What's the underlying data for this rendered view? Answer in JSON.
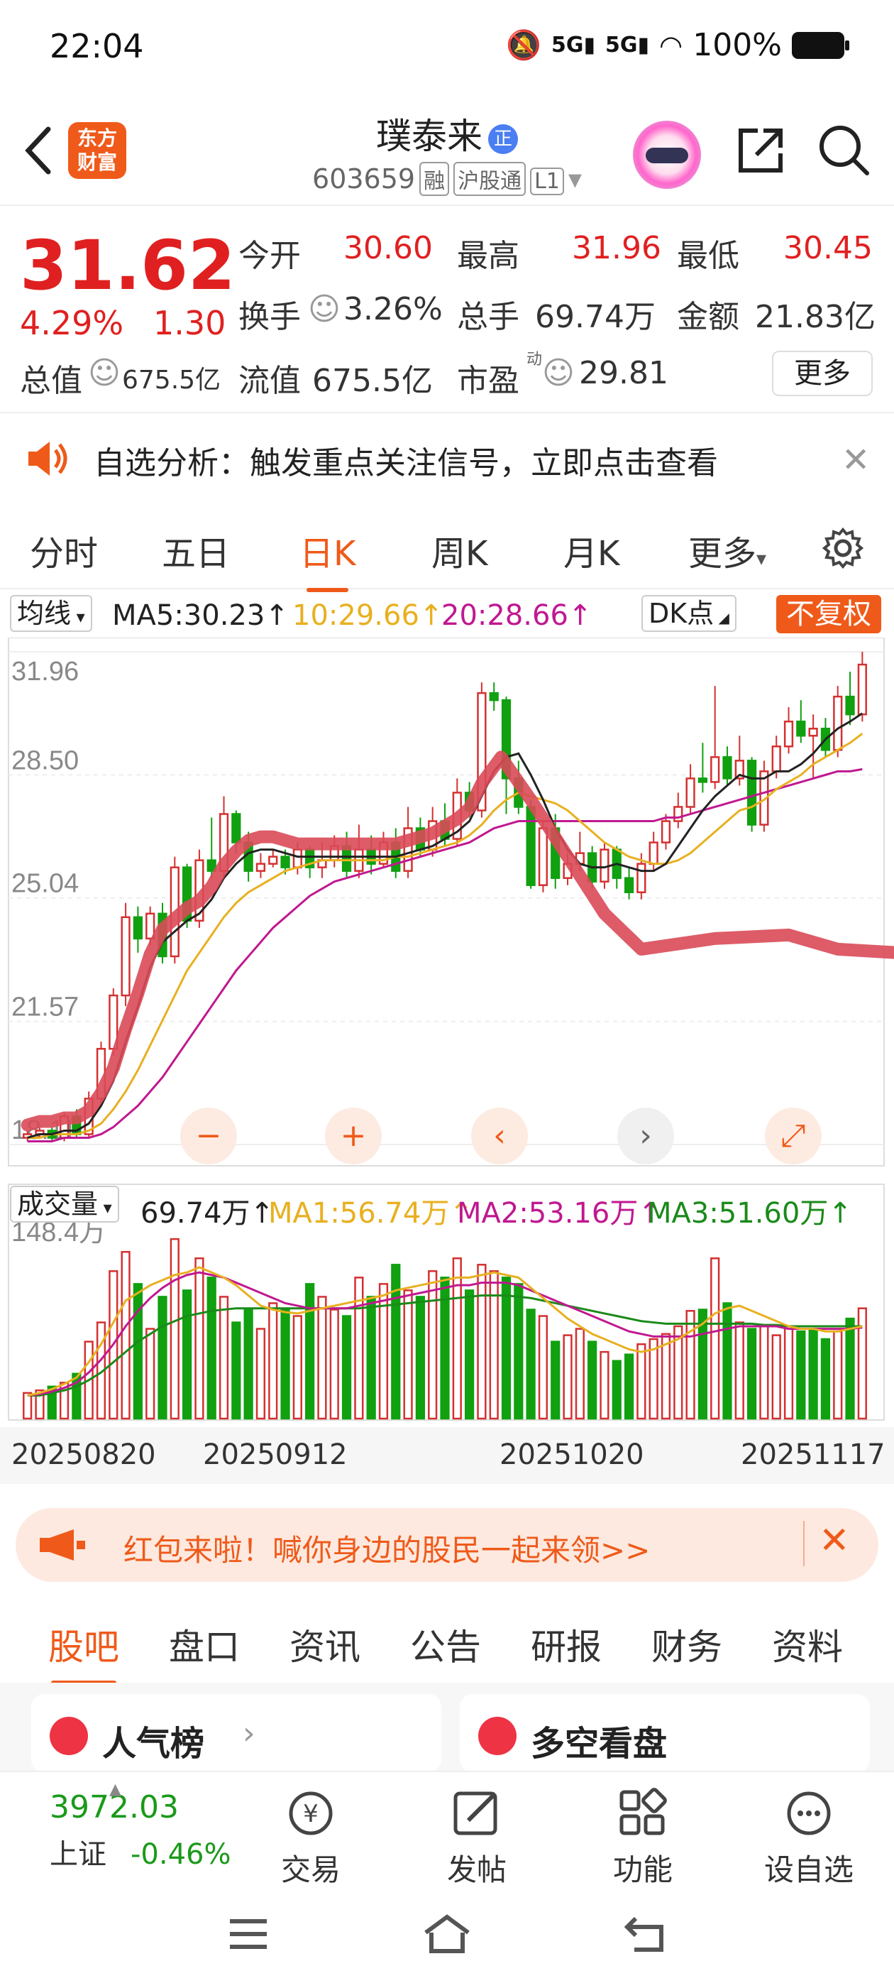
{
  "status": {
    "time": "22:04",
    "network": "5G",
    "battery": "100%"
  },
  "header": {
    "logo_line1": "东方",
    "logo_line2": "财富",
    "name": "璞泰来",
    "badge": "正",
    "code": "603659",
    "tags": [
      "融",
      "沪股通",
      "L1"
    ]
  },
  "quote": {
    "price": "31.62",
    "pct": "4.29%",
    "change": "1.30",
    "open_label": "今开",
    "open": "30.60",
    "high_label": "最高",
    "high": "31.96",
    "low_label": "最低",
    "low": "30.45",
    "turnover_label": "换手",
    "turnover": "3.26%",
    "volume_label": "总手",
    "volume": "69.74万",
    "amount_label": "金额",
    "amount": "21.83亿",
    "mcap_label": "总值",
    "mcap": "675.5亿",
    "float_label": "流值",
    "float": "675.5亿",
    "pe_label": "市盈",
    "pe_sup": "动",
    "pe": "29.81",
    "more": "更多"
  },
  "notice": {
    "text": "自选分析：触发重点关注信号，立即点击查看"
  },
  "tabs": [
    "分时",
    "五日",
    "日K",
    "周K",
    "月K",
    "更多"
  ],
  "ma": {
    "selector": "均线",
    "ma5": "MA5:30.23",
    "ma10": "10:29.66",
    "ma20": "20:28.66",
    "dk": "DK点",
    "restore": "不复权"
  },
  "vol": {
    "selector": "成交量",
    "value": "69.74万",
    "ma1": "MA1:56.74万",
    "ma2": "MA2:53.16万",
    "ma3": "MA3:51.60万",
    "max": "148.4万"
  },
  "chart_data": {
    "type": "candlestick",
    "y_ticks": [
      "31.96",
      "28.50",
      "25.04",
      "21.57",
      "18.11"
    ],
    "dates": [
      "20250820",
      "20250912",
      "20251020",
      "20251117"
    ],
    "colors": {
      "up": "#d43030",
      "down": "#10a010",
      "ma5": "#222222",
      "ma10": "#e8b020",
      "ma20": "#c01890",
      "ma3": "#1a8a1a"
    },
    "ylim": [
      18.11,
      31.96
    ],
    "candles": [
      [
        18.3,
        18.4,
        18.2,
        18.5
      ],
      [
        18.4,
        18.5,
        18.3,
        18.6
      ],
      [
        18.5,
        18.3,
        18.2,
        18.6
      ],
      [
        18.3,
        18.9,
        18.2,
        19.0
      ],
      [
        18.9,
        18.4,
        18.3,
        19.1
      ],
      [
        18.4,
        19.4,
        18.3,
        19.6
      ],
      [
        19.4,
        20.8,
        19.2,
        21.0
      ],
      [
        20.8,
        22.3,
        20.6,
        22.5
      ],
      [
        22.3,
        24.5,
        22.0,
        24.9
      ],
      [
        24.5,
        23.9,
        23.5,
        24.8
      ],
      [
        23.9,
        24.6,
        23.7,
        24.8
      ],
      [
        24.6,
        23.4,
        23.2,
        24.9
      ],
      [
        23.4,
        25.9,
        23.2,
        26.2
      ],
      [
        25.9,
        24.4,
        24.2,
        26.0
      ],
      [
        24.4,
        26.1,
        24.2,
        26.4
      ],
      [
        26.1,
        25.8,
        25.6,
        27.3
      ],
      [
        25.8,
        27.4,
        25.6,
        27.9
      ],
      [
        27.4,
        26.6,
        26.3,
        27.5
      ],
      [
        26.6,
        25.8,
        25.5,
        26.9
      ],
      [
        25.8,
        26.0,
        25.6,
        26.3
      ],
      [
        26.0,
        26.2,
        25.9,
        26.4
      ],
      [
        26.2,
        25.9,
        25.7,
        26.4
      ],
      [
        25.9,
        26.4,
        25.7,
        26.6
      ],
      [
        26.4,
        25.9,
        25.6,
        26.5
      ],
      [
        25.9,
        26.1,
        25.6,
        26.6
      ],
      [
        26.1,
        26.5,
        25.9,
        26.8
      ],
      [
        26.5,
        25.8,
        25.6,
        26.9
      ],
      [
        25.8,
        26.4,
        25.6,
        27.1
      ],
      [
        26.4,
        26.0,
        25.7,
        26.8
      ],
      [
        26.0,
        26.6,
        25.9,
        26.9
      ],
      [
        26.6,
        25.8,
        25.6,
        27.0
      ],
      [
        25.8,
        27.0,
        25.6,
        27.6
      ],
      [
        27.0,
        26.4,
        26.2,
        27.3
      ],
      [
        26.4,
        27.2,
        26.2,
        27.6
      ],
      [
        27.2,
        26.7,
        26.5,
        27.7
      ],
      [
        26.7,
        28.0,
        26.5,
        28.4
      ],
      [
        28.0,
        27.5,
        27.3,
        28.3
      ],
      [
        27.5,
        30.8,
        27.3,
        31.1
      ],
      [
        30.8,
        30.6,
        30.3,
        31.1
      ],
      [
        30.6,
        28.4,
        27.4,
        30.7
      ],
      [
        28.4,
        27.6,
        27.4,
        28.9
      ],
      [
        27.6,
        25.4,
        25.3,
        27.8
      ],
      [
        25.4,
        27.0,
        25.2,
        27.2
      ],
      [
        27.0,
        25.6,
        25.3,
        27.4
      ],
      [
        25.6,
        26.0,
        25.4,
        26.3
      ],
      [
        26.0,
        26.3,
        25.8,
        26.9
      ],
      [
        26.3,
        25.5,
        25.3,
        26.5
      ],
      [
        25.5,
        26.4,
        25.3,
        26.6
      ],
      [
        26.4,
        25.6,
        25.3,
        26.5
      ],
      [
        25.6,
        25.2,
        25.0,
        25.9
      ],
      [
        25.2,
        26.0,
        25.0,
        26.3
      ],
      [
        26.0,
        26.6,
        25.8,
        26.9
      ],
      [
        26.6,
        27.2,
        26.4,
        27.4
      ],
      [
        27.2,
        27.6,
        27.0,
        28.0
      ],
      [
        27.6,
        28.4,
        27.4,
        28.8
      ],
      [
        28.4,
        28.3,
        28.0,
        29.4
      ],
      [
        28.3,
        29.0,
        28.1,
        31.0
      ],
      [
        29.0,
        28.4,
        28.2,
        29.3
      ],
      [
        28.4,
        28.9,
        28.2,
        29.6
      ],
      [
        28.9,
        27.1,
        26.9,
        29.0
      ],
      [
        27.1,
        28.6,
        26.9,
        28.9
      ],
      [
        28.6,
        29.3,
        28.4,
        29.6
      ],
      [
        29.3,
        30.0,
        29.1,
        30.4
      ],
      [
        30.0,
        29.6,
        29.4,
        30.6
      ],
      [
        29.6,
        29.8,
        28.4,
        30.2
      ],
      [
        29.8,
        29.2,
        29.0,
        30.1
      ],
      [
        29.2,
        30.7,
        29.0,
        31.0
      ],
      [
        30.7,
        30.2,
        29.9,
        31.4
      ],
      [
        30.2,
        31.6,
        30.0,
        31.96
      ]
    ],
    "ma5": [
      18.3,
      18.4,
      18.4,
      18.5,
      18.5,
      18.7,
      19.2,
      19.9,
      21.0,
      22.0,
      23.1,
      23.8,
      24.1,
      24.4,
      24.6,
      25.0,
      25.6,
      26.0,
      26.3,
      26.4,
      26.4,
      26.3,
      26.2,
      26.2,
      26.2,
      26.2,
      26.2,
      26.2,
      26.2,
      26.2,
      26.2,
      26.3,
      26.4,
      26.5,
      26.7,
      26.9,
      27.2,
      27.9,
      28.6,
      29.0,
      29.1,
      28.5,
      27.8,
      27.0,
      26.4,
      26.0,
      25.9,
      25.9,
      26.0,
      25.9,
      25.8,
      25.8,
      26.0,
      26.5,
      27.0,
      27.5,
      27.9,
      28.2,
      28.5,
      28.4,
      28.4,
      28.6,
      28.6,
      28.8,
      29.1,
      29.5,
      29.8,
      30.0,
      30.23
    ],
    "ma10": [
      18.3,
      18.3,
      18.4,
      18.4,
      18.4,
      18.5,
      18.7,
      19.1,
      19.6,
      20.2,
      20.9,
      21.6,
      22.3,
      23.0,
      23.5,
      24.0,
      24.5,
      24.9,
      25.2,
      25.4,
      25.6,
      25.8,
      25.9,
      26.0,
      26.1,
      26.1,
      26.1,
      26.1,
      26.1,
      26.1,
      26.2,
      26.2,
      26.3,
      26.4,
      26.5,
      26.6,
      26.8,
      27.1,
      27.5,
      27.8,
      28.0,
      27.9,
      27.8,
      27.7,
      27.5,
      27.2,
      26.9,
      26.6,
      26.4,
      26.2,
      26.1,
      26.0,
      26.0,
      26.1,
      26.3,
      26.6,
      26.9,
      27.2,
      27.5,
      27.6,
      27.8,
      28.1,
      28.3,
      28.5,
      28.8,
      29.0,
      29.2,
      29.4,
      29.66
    ],
    "ma20": [
      18.2,
      18.2,
      18.2,
      18.3,
      18.3,
      18.3,
      18.4,
      18.6,
      18.9,
      19.2,
      19.6,
      20.0,
      20.5,
      21.0,
      21.5,
      22.0,
      22.5,
      23.0,
      23.4,
      23.8,
      24.2,
      24.5,
      24.8,
      25.1,
      25.3,
      25.5,
      25.6,
      25.7,
      25.8,
      25.9,
      26.0,
      26.1,
      26.2,
      26.3,
      26.4,
      26.5,
      26.6,
      26.8,
      27.0,
      27.1,
      27.2,
      27.2,
      27.2,
      27.2,
      27.2,
      27.2,
      27.2,
      27.2,
      27.2,
      27.2,
      27.2,
      27.2,
      27.3,
      27.3,
      27.4,
      27.5,
      27.6,
      27.7,
      27.8,
      27.9,
      28.0,
      28.1,
      28.2,
      28.3,
      28.4,
      28.5,
      28.6,
      28.6,
      28.66
    ],
    "volumes": [
      20,
      22,
      25,
      28,
      35,
      60,
      75,
      115,
      130,
      105,
      70,
      95,
      140,
      100,
      125,
      110,
      95,
      75,
      85,
      70,
      90,
      85,
      80,
      105,
      95,
      85,
      80,
      110,
      95,
      105,
      120,
      100,
      95,
      115,
      110,
      125,
      100,
      120,
      115,
      110,
      105,
      85,
      80,
      60,
      65,
      70,
      60,
      52,
      45,
      50,
      58,
      62,
      66,
      72,
      84,
      85,
      125,
      90,
      75,
      70,
      72,
      65,
      72,
      68,
      70,
      62,
      68,
      78,
      86
    ],
    "vol_up": [
      true,
      true,
      false,
      true,
      false,
      true,
      true,
      true,
      true,
      false,
      true,
      false,
      true,
      false,
      true,
      false,
      true,
      false,
      false,
      true,
      true,
      false,
      true,
      false,
      true,
      true,
      false,
      true,
      false,
      true,
      false,
      true,
      false,
      true,
      false,
      true,
      false,
      true,
      true,
      false,
      false,
      false,
      true,
      false,
      true,
      true,
      false,
      true,
      false,
      false,
      true,
      true,
      true,
      true,
      true,
      false,
      true,
      false,
      true,
      false,
      true,
      true,
      true,
      false,
      false,
      false,
      true,
      false,
      true
    ],
    "vol_ma1": [
      18,
      20,
      23,
      27,
      32,
      44,
      58,
      75,
      92,
      98,
      104,
      108,
      112,
      114,
      118,
      114,
      110,
      104,
      96,
      88,
      85,
      83,
      82,
      84,
      86,
      88,
      90,
      92,
      94,
      96,
      100,
      102,
      104,
      106,
      108,
      110,
      110,
      112,
      114,
      112,
      110,
      102,
      94,
      86,
      78,
      72,
      66,
      62,
      58,
      54,
      52,
      54,
      58,
      62,
      68,
      74,
      82,
      86,
      88,
      84,
      80,
      76,
      72,
      70,
      70,
      68,
      68,
      70,
      72
    ],
    "vol_ma2": [
      18,
      19,
      21,
      24,
      28,
      36,
      46,
      58,
      72,
      84,
      94,
      102,
      108,
      112,
      114,
      112,
      110,
      106,
      102,
      98,
      94,
      90,
      88,
      86,
      86,
      86,
      86,
      88,
      90,
      92,
      94,
      96,
      98,
      100,
      102,
      104,
      104,
      106,
      106,
      106,
      104,
      100,
      96,
      92,
      88,
      84,
      80,
      76,
      72,
      68,
      66,
      64,
      64,
      64,
      64,
      66,
      68,
      70,
      72,
      72,
      72,
      72,
      70,
      70,
      70,
      70,
      70,
      70,
      71
    ],
    "vol_ma3": [
      18,
      18,
      20,
      22,
      25,
      30,
      36,
      44,
      52,
      60,
      66,
      72,
      76,
      80,
      82,
      84,
      85,
      86,
      86,
      86,
      86,
      86,
      86,
      86,
      86,
      86,
      86,
      86,
      87,
      88,
      89,
      90,
      91,
      92,
      93,
      94,
      95,
      96,
      96,
      96,
      95,
      94,
      92,
      90,
      88,
      86,
      84,
      82,
      80,
      78,
      76,
      75,
      74,
      74,
      74,
      74,
      74,
      74,
      74,
      74,
      73,
      73,
      72,
      72,
      72,
      72,
      72,
      72,
      72
    ]
  },
  "chart_buttons": [
    "−",
    "+",
    "‹",
    "›",
    "⤢"
  ],
  "banner": {
    "text": "红包来啦！喊你身边的股民一起来领>>"
  },
  "tabs2": [
    "股吧",
    "盘口",
    "资讯",
    "公告",
    "研报",
    "财务",
    "资料"
  ],
  "cards": [
    {
      "title": "人气榜"
    },
    {
      "title": "多空看盘"
    }
  ],
  "bottom": {
    "index_value": "3972.03",
    "index_name": "上证",
    "index_change": "-0.46%",
    "trade": "交易",
    "post": "发帖",
    "func": "功能",
    "watch": "设自选"
  }
}
